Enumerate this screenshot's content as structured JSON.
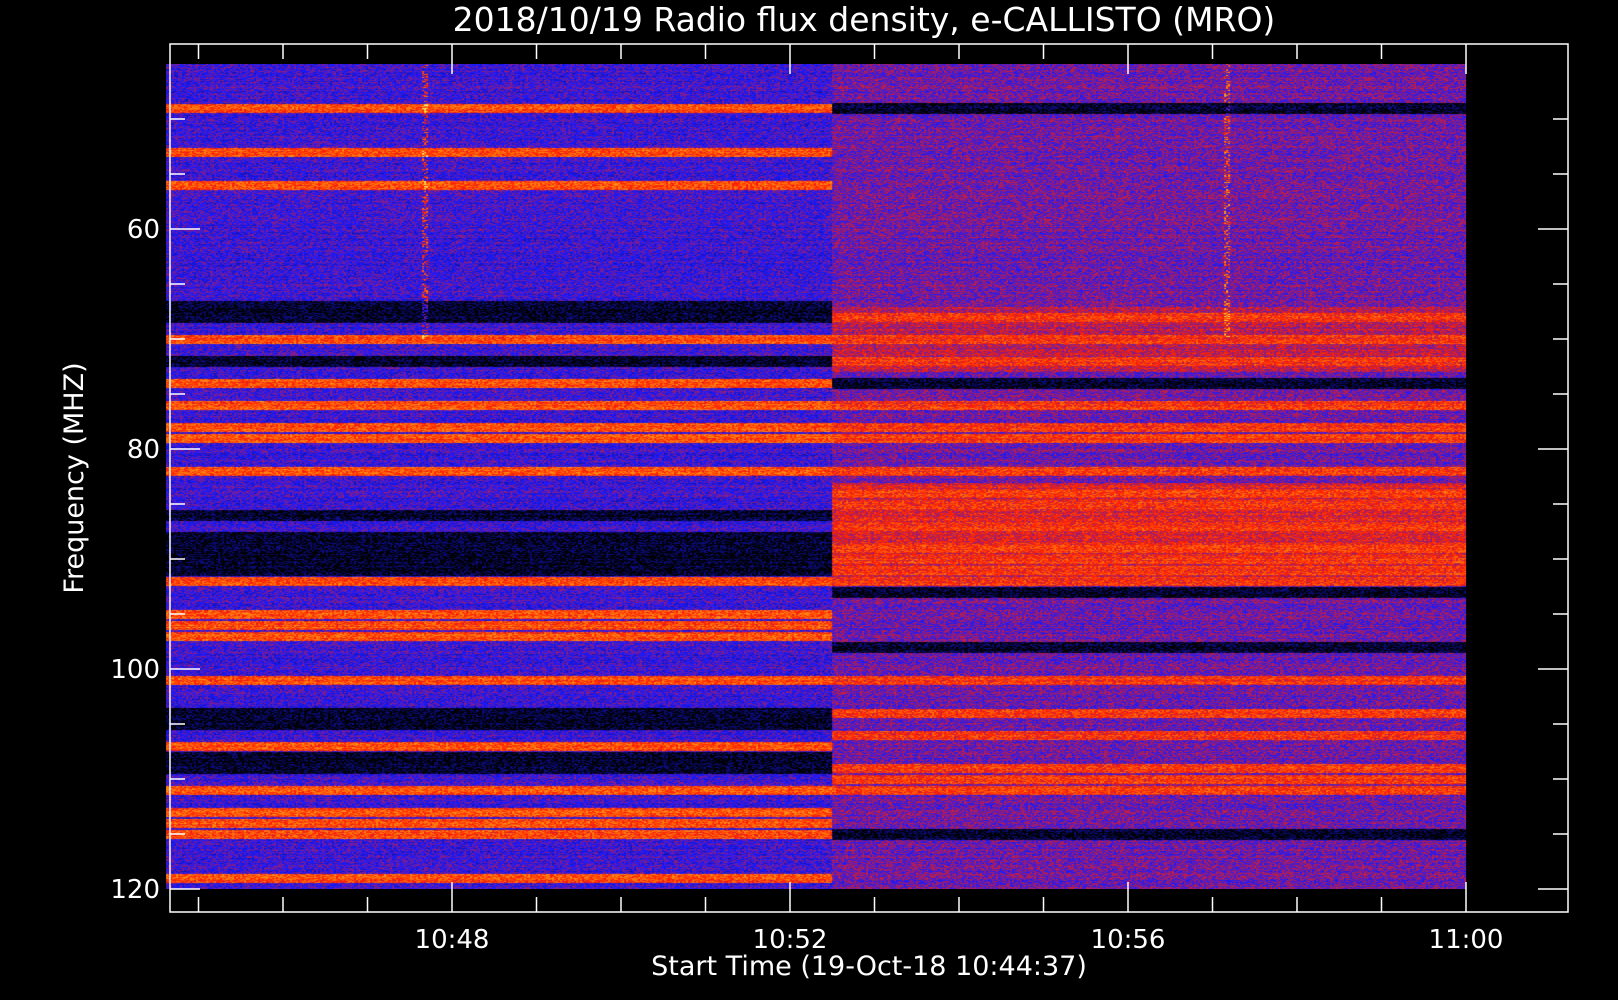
{
  "chart_data": {
    "type": "heatmap",
    "title": "2018/10/19  Radio flux density, e-CALLISTO (MRO)",
    "xlabel": "Start Time (19-Oct-18 10:44:37)",
    "ylabel": "Frequency (MHZ)",
    "x_ticks": [
      "10:48",
      "10:52",
      "10:56",
      "11:00"
    ],
    "y_ticks": [
      "60",
      "80",
      "100",
      "120"
    ],
    "x_range": [
      "10:44:37",
      "11:00:00"
    ],
    "ylim": [
      45,
      122
    ],
    "y_axis_inverted": true,
    "data_frequency_range_mhz": [
      45,
      120
    ],
    "colormap": [
      "#000000",
      "#1a1aff",
      "#ff2000",
      "#ffd020",
      "#ffffff"
    ],
    "background_level_change_time": "10:52:30",
    "bright_bands_mhz": {
      "before_10:52:30": [
        49,
        53,
        56,
        70,
        74,
        76,
        78,
        79,
        82,
        92,
        95,
        96,
        97,
        101,
        107,
        111,
        113,
        114,
        115,
        119
      ],
      "after_10:52:30": [
        68,
        70,
        72,
        76,
        78,
        79,
        82,
        84,
        85,
        87,
        89,
        90,
        91,
        92,
        101,
        104,
        106,
        109,
        110,
        111
      ]
    },
    "dark_bands_mhz": {
      "before_10:52:30": [
        67,
        68,
        72,
        86,
        88,
        89,
        90,
        91,
        104,
        105,
        108,
        109
      ],
      "after_10:52:30": [
        49,
        74,
        93,
        98,
        115
      ]
    },
    "transient_times": [
      "10:47:40",
      "10:57:10"
    ]
  }
}
